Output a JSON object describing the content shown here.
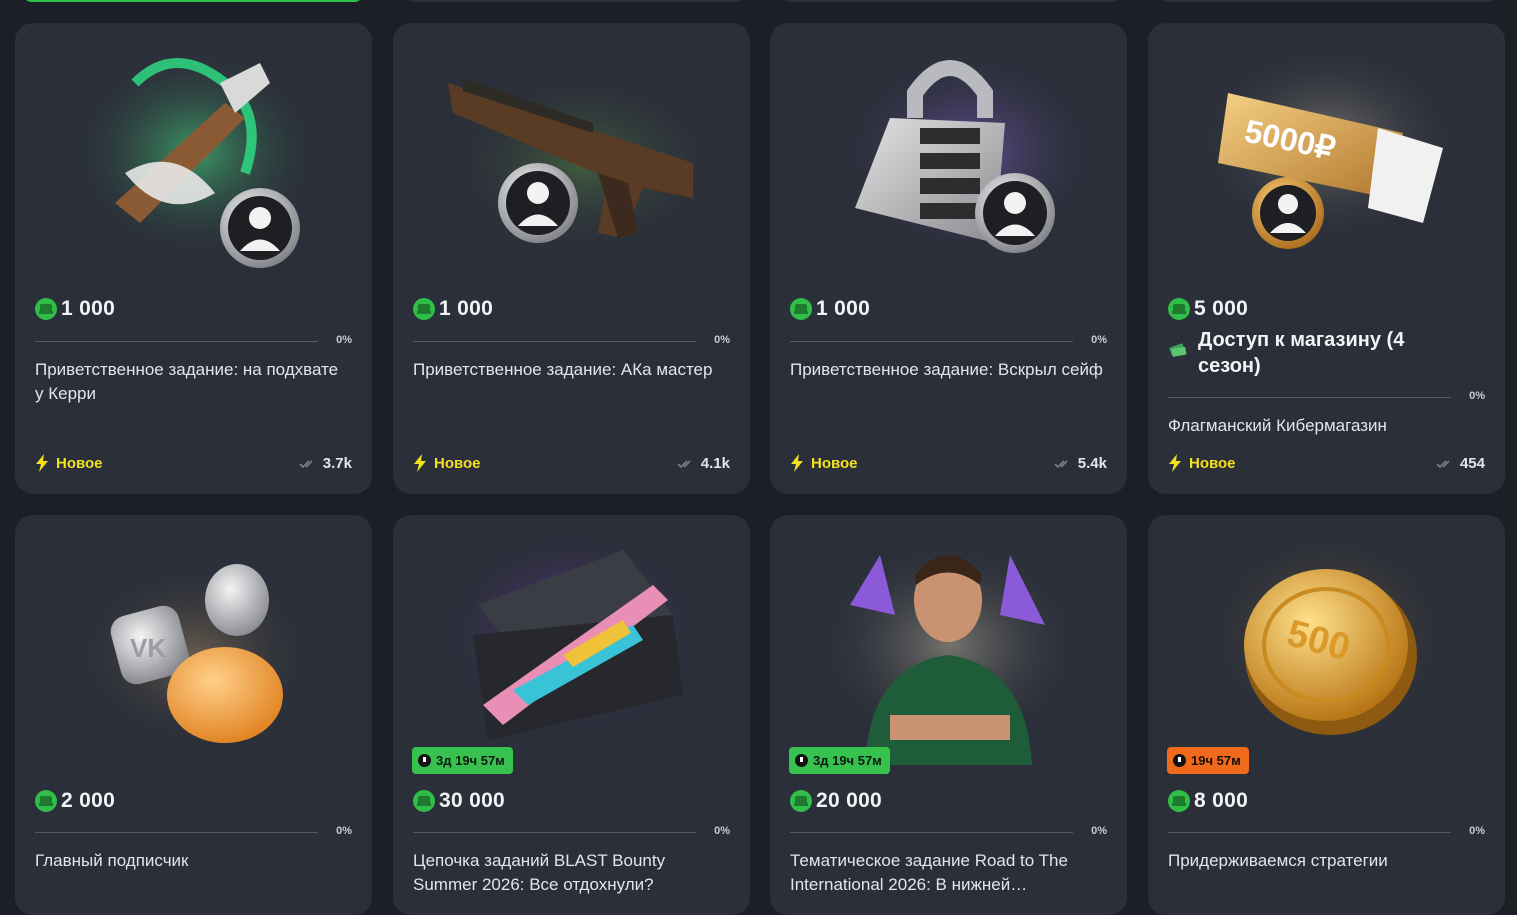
{
  "cards": [
    {
      "price": "1 000",
      "progress": "0%",
      "title": "Приветственное задание: на подхвате у Керри",
      "status": "Новое",
      "completions": "3.7k",
      "art": "knife-skin-with-avatar-coin"
    },
    {
      "price": "1 000",
      "progress": "0%",
      "title": "Приветственное задание: АКа мастер",
      "status": "Новое",
      "completions": "4.1k",
      "art": "ak47-rifle-with-avatar-coin"
    },
    {
      "price": "1 000",
      "progress": "0%",
      "title": "Приветственное задание: Вскрыл сейф",
      "status": "Новое",
      "completions": "5.4k",
      "art": "combination-padlock-with-avatar-coin"
    },
    {
      "price": "5 000",
      "bonus": "Доступ к магазину (4 сезон)",
      "progress": "0%",
      "title": "Флагманский Кибермагазин",
      "status": "Новое",
      "completions": "454",
      "art": "gift-card-5000-with-avatar-coin",
      "art_text": "5000₽"
    },
    {
      "price": "2 000",
      "progress": "0%",
      "title": "Главный подписчик",
      "art": "vk-and-social-coins"
    },
    {
      "price": "30 000",
      "timer": "3д 19ч 57м",
      "timer_color": "#37c24f",
      "progress": "0%",
      "title": "Цепочка заданий BLAST Bounty Summer 2026: Все отдохнули?",
      "art": "open-case-with-skins"
    },
    {
      "price": "20 000",
      "timer": "3д 19ч 57м",
      "timer_color": "#37c24f",
      "progress": "0%",
      "title": "Тематическое задание Road to The International 2026: В нижней…",
      "art": "esports-player-portrait"
    },
    {
      "price": "8 000",
      "timer": "19ч 57м",
      "timer_color": "#f06a1c",
      "progress": "0%",
      "title": "Придерживаемся стратегии",
      "art": "gold-coin-500",
      "art_text": "500"
    }
  ],
  "colors": {
    "accent_green": "#2fbf48",
    "status_yellow": "#f3e11e",
    "card_bg": "#2b2f39",
    "page_bg": "#1c1f26"
  }
}
